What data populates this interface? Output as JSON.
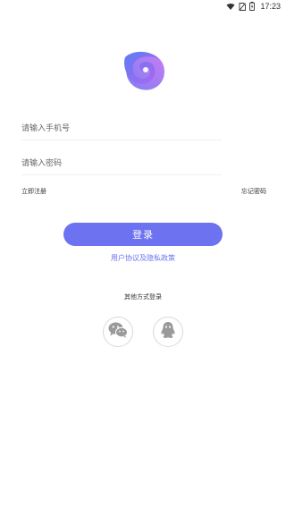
{
  "status_bar": {
    "time": "17:23",
    "icons": [
      "wifi-icon",
      "no-sim-icon",
      "battery-icon"
    ]
  },
  "logo": {
    "name": "app-logo",
    "colors": [
      "#6c72f0",
      "#b164f0"
    ]
  },
  "form": {
    "phone_placeholder": "请输入手机号",
    "password_placeholder": "请输入密码"
  },
  "links": {
    "register": "立即注册",
    "forgot_password": "忘记密码"
  },
  "login_button": "登录",
  "agreement": {
    "user_agreement": "用户协议",
    "and": "及",
    "privacy_policy": "隐私政策"
  },
  "other_login": {
    "title": "其他方式登录",
    "options": [
      "wechat-icon",
      "qq-icon"
    ]
  },
  "colors": {
    "accent": "#6c72f0",
    "icon_gray": "#9a9a9a"
  }
}
